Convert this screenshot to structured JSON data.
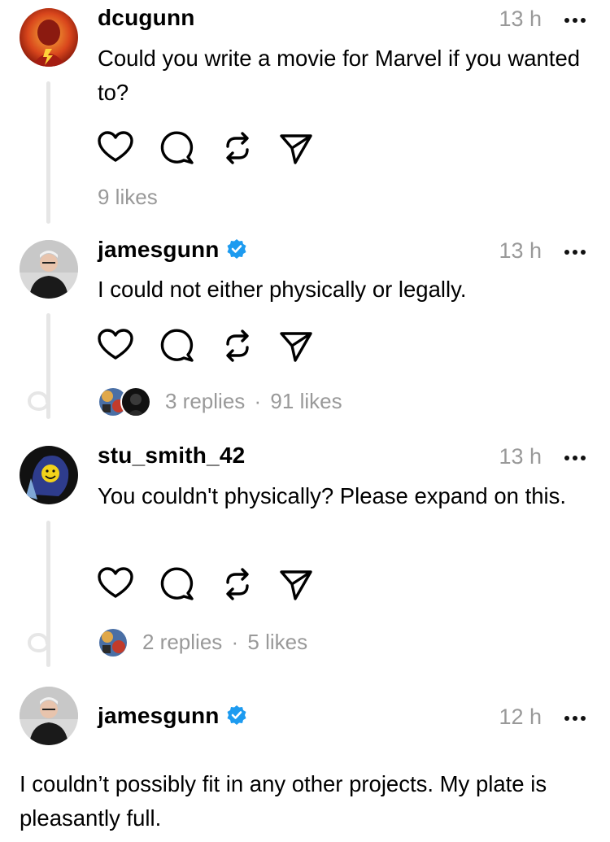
{
  "posts": [
    {
      "username": "dcugunn",
      "verified": false,
      "time": "13 h",
      "text": "Could you write a movie for Marvel if you wanted to?",
      "stats": "9 likes"
    },
    {
      "username": "jamesgunn",
      "verified": true,
      "time": "13 h",
      "text": "I could not either physically or legally.",
      "replies": "3 replies",
      "separator": "·",
      "likes": "91 likes"
    },
    {
      "username": "stu_smith_42",
      "verified": false,
      "time": "13 h",
      "text": "You couldn't physically? Please expand on this.",
      "replies": "2 replies",
      "separator": "·",
      "likes": "5 likes"
    },
    {
      "username": "jamesgunn",
      "verified": true,
      "time": "12 h",
      "text": "I couldn’t possibly fit in any other projects. My plate is pleasantly full."
    }
  ],
  "icons": {
    "like": "heart-icon",
    "reply": "comment-icon",
    "repost": "repost-icon",
    "share": "send-icon",
    "more": "more-icon",
    "verified": "verified-badge-icon"
  },
  "colors": {
    "verified": "#1d9bf0",
    "muted": "#999999",
    "thread_line": "#e6e6e6"
  }
}
